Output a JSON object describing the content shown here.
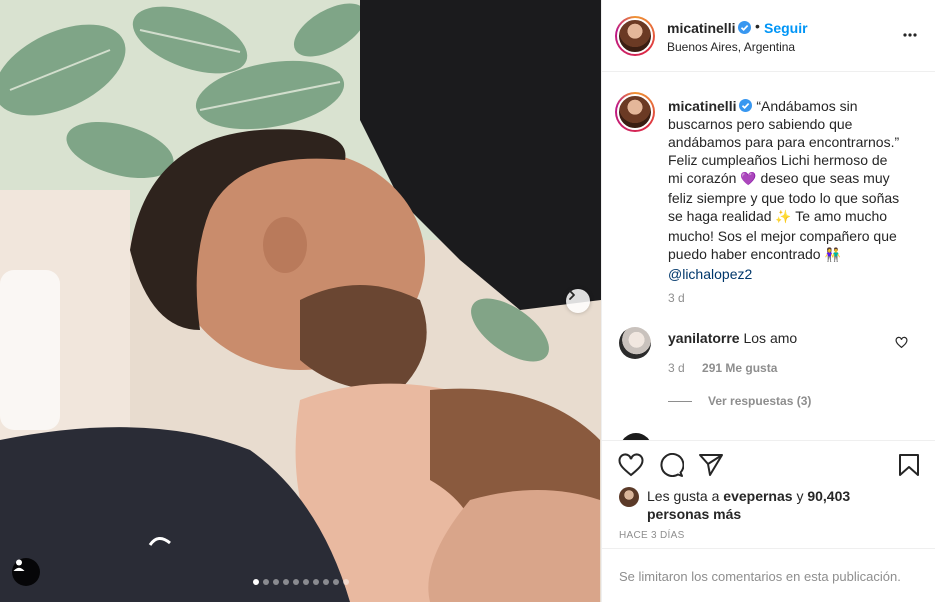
{
  "post": {
    "header": {
      "username": "micatinelli",
      "separator": "•",
      "follow_label": "Seguir",
      "location": "Buenos Aires, Argentina"
    },
    "caption": {
      "username": "micatinelli",
      "line1": "“Andábamos sin buscarnos pero sabiendo que andábamos para para encontrarnos.” Feliz cumpleaños Lichi hermoso de mi corazón",
      "emoji1": "💜",
      "line2": "deseo que seas muy feliz siempre y que todo lo que soñas se haga realidad",
      "emoji2": "✨",
      "line3": "Te amo mucho mucho! Sos el mejor compañero que puedo haber encontrado",
      "emoji3": "👫",
      "mention": "@lichalopez2",
      "time": "3 d"
    },
    "comment": {
      "username": "yanilatorre",
      "text": "Los amo",
      "time": "3 d",
      "likes": "291 Me gusta",
      "replies_label": "Ver respuestas (3)"
    },
    "likes": {
      "prefix": "Les gusta a",
      "user": "evepernas",
      "joiner": "y",
      "others": "90,403 personas más"
    },
    "timestamp": "HACE 3 DÍAS",
    "comments_limited": "Se limitaron los comentarios en esta publicación.",
    "carousel": {
      "total": 10,
      "active_index": 0
    }
  },
  "icons": [
    "verified-badge-icon",
    "more-options-icon",
    "heart-icon",
    "comment-icon",
    "share-icon",
    "save-icon",
    "chevron-right-icon",
    "user-tag-icon"
  ],
  "colors": {
    "link_blue": "#0095f6",
    "mention_blue": "#00376b",
    "muted": "#8e8e8e",
    "text": "#262626",
    "verified": "#3897f0"
  }
}
